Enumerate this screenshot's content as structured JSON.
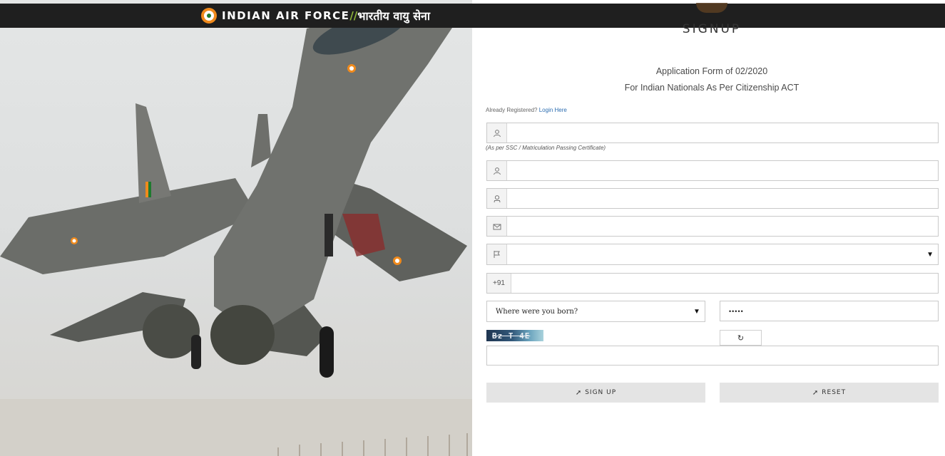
{
  "header": {
    "title_en": "INDIAN AIR FORCE",
    "separator": "//",
    "title_hi": "भारतीय वायु सेना"
  },
  "form": {
    "heading": "SIGNUP",
    "subtitle_line1": "Application Form of 02/2020",
    "subtitle_line2": "For Indian Nationals As Per Citizenship ACT",
    "already_registered": "Already Registered?",
    "login_link": "Login Here",
    "name_note": "(As per SSC / Matriculation Passing Certificate)",
    "phone_prefix": "+91",
    "security_question": "Where were you born?",
    "answer_value": "•••••",
    "captcha_text": "Bz T 4E",
    "signup_button": "SIGN UP",
    "reset_button": "RESET"
  },
  "icons": {
    "name": "user-icon",
    "father": "user-icon",
    "dob": "user-outline-icon",
    "email": "envelope-icon",
    "nationality": "flag-icon",
    "captcha_refresh": "refresh-icon",
    "signup": "paper-plane-icon",
    "reset": "paper-plane-icon"
  }
}
